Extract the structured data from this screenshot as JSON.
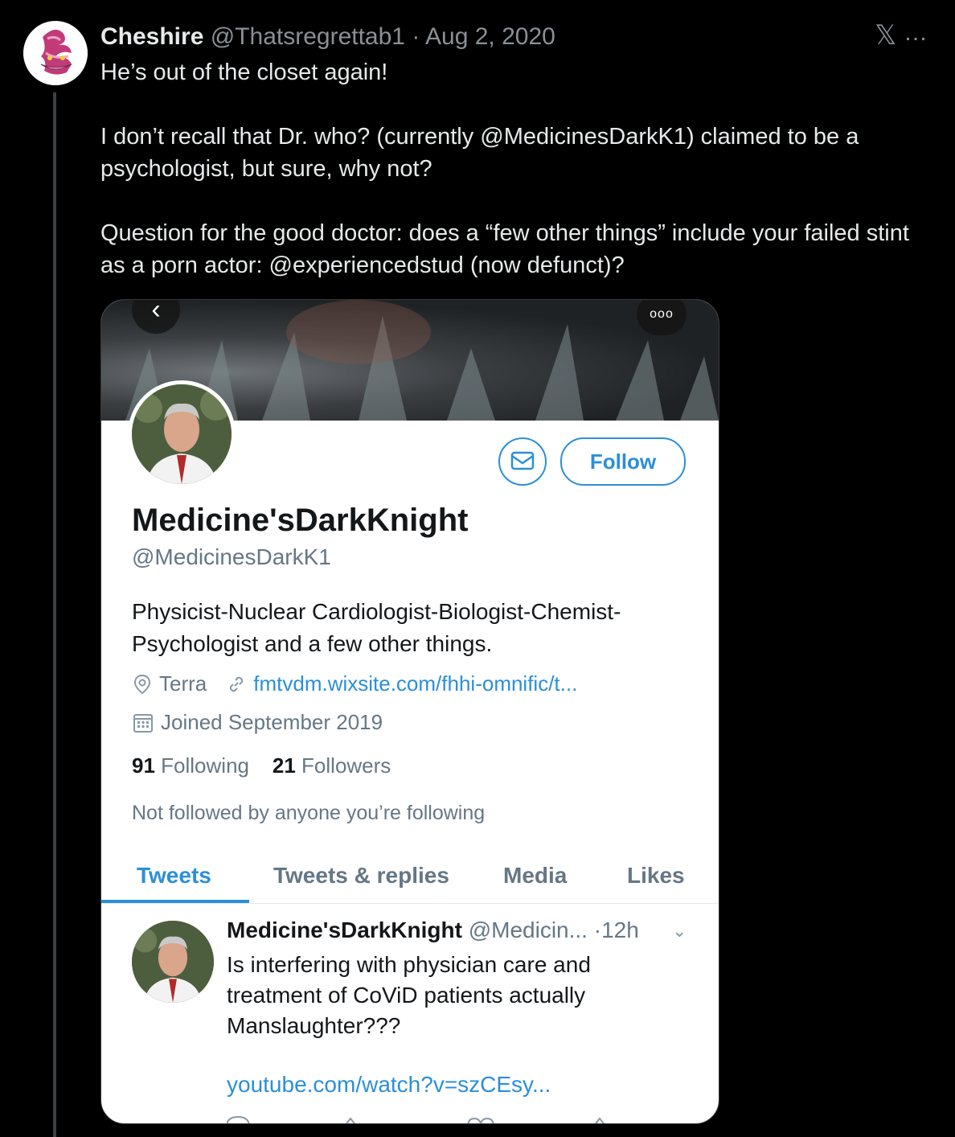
{
  "tweet": {
    "author_name": "Cheshire",
    "author_handle": "@Thatsregrettab1",
    "separator": "·",
    "date": "Aug 2, 2020",
    "lines": [
      "He’s out of the closet again!",
      "I don’t recall that Dr. who? (currently @MedicinesDarkK1) claimed to be a psychologist, but sure, why not?",
      "Question for the good doctor: does a “few other things” include your failed stint as a porn actor: @experiencedstud (now defunct)?"
    ],
    "more_icon": "…"
  },
  "screenshot": {
    "more_label": "ooo",
    "profile": {
      "follow_label": "Follow",
      "name": "Medicine'sDarkKnight",
      "handle": "@MedicinesDarkK1",
      "bio": "Physicist-Nuclear Cardiologist-Biologist-Chemist-Psychologist and a few other things.",
      "location": "Terra",
      "website": "fmtvdm.wixsite.com/fhhi-omnific/t...",
      "joined": "Joined September 2019",
      "following_count": "91",
      "following_label": "Following",
      "followers_count": "21",
      "followers_label": "Followers",
      "not_followed": "Not followed by anyone you’re following"
    },
    "tabs": [
      "Tweets",
      "Tweets & replies",
      "Media",
      "Likes"
    ],
    "active_tab": "Tweets",
    "pinned_tweet": {
      "name": "Medicine'sDarkKnight",
      "handle": "@Medicin...",
      "time": "·12h",
      "text": "Is interfering with physician care and treatment of CoViD patients actually Manslaughter???",
      "link": "youtube.com/watch?v=szCEsy..."
    }
  },
  "colors": {
    "accent": "#2b8fd9",
    "background": "#000000",
    "muted": "#8b9096"
  }
}
